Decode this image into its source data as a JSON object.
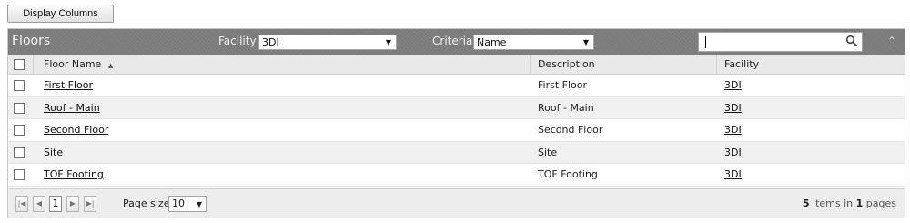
{
  "toolbar": {
    "display_columns_label": "Display Columns"
  },
  "grid": {
    "title": "Floors",
    "filters": {
      "facility_label": "Facility",
      "facility_value": "3DI",
      "criteria_label": "Criteria",
      "criteria_value": "Name",
      "search_value": ""
    },
    "columns": {
      "floor_name": "Floor Name",
      "description": "Description",
      "facility": "Facility"
    },
    "sort": {
      "column": "Floor Name",
      "direction": "ascending"
    },
    "rows": [
      {
        "floor_name": "First Floor",
        "description": "First Floor",
        "facility": "3DI"
      },
      {
        "floor_name": "Roof - Main",
        "description": "Roof - Main",
        "facility": "3DI"
      },
      {
        "floor_name": "Second Floor",
        "description": "Second Floor",
        "facility": "3DI"
      },
      {
        "floor_name": "Site",
        "description": "Site",
        "facility": "3DI"
      },
      {
        "floor_name": "TOF Footing",
        "description": "TOF Footing",
        "facility": "3DI"
      }
    ],
    "pager": {
      "current_page": "1",
      "page_size_label": "Page size:",
      "page_size": "10",
      "items_count": "5",
      "items_text": "items in",
      "pages_count": "1",
      "pages_text": "pages"
    }
  },
  "colors": {
    "header_bar": "#7b7b7b",
    "column_header": "#e9e9e9",
    "alt_row": "#f0f0f0"
  }
}
